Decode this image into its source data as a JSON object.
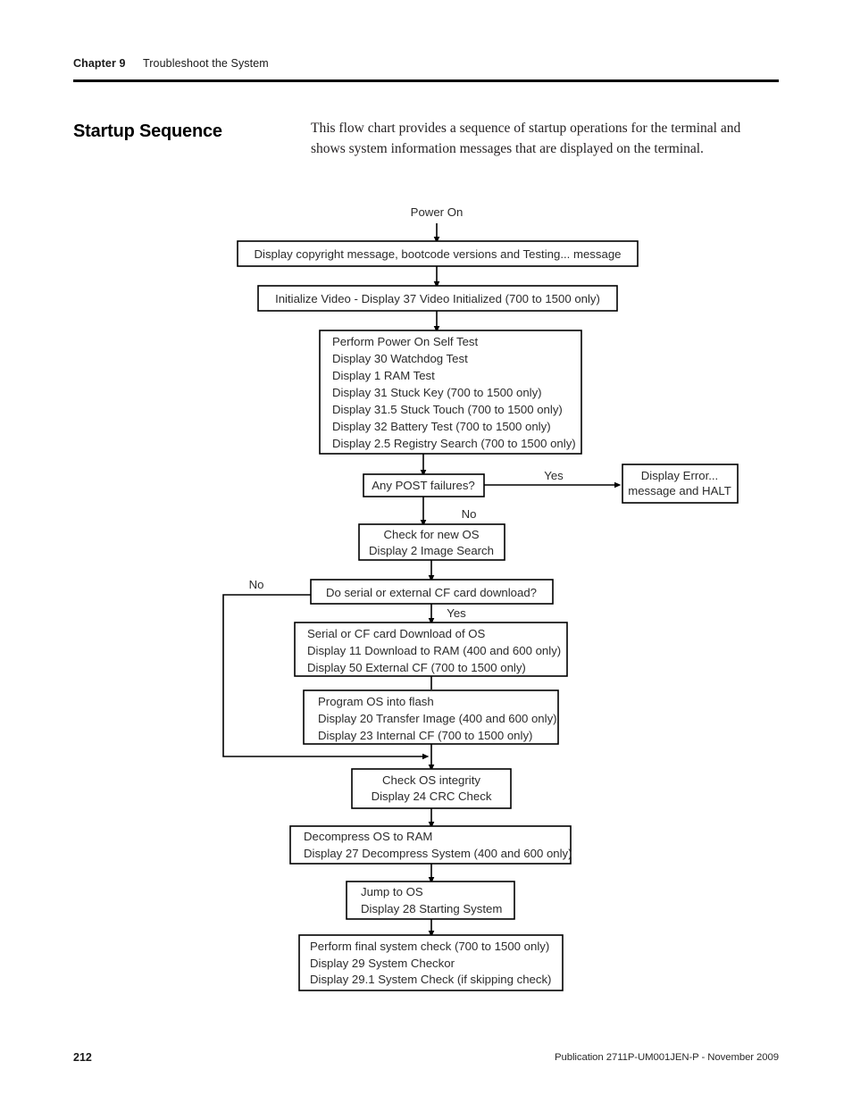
{
  "header": {
    "chapter": "Chapter 9",
    "title": "Troubleshoot the System"
  },
  "section": {
    "title": "Startup Sequence",
    "intro": "This flow chart provides a sequence of startup operations for the terminal and shows system information messages that are displayed on the terminal."
  },
  "flowchart": {
    "start_label": "Power On",
    "nodes": {
      "copyright": "Display copyright message, bootcode versions and Testing... message",
      "init_video": "Initialize Video - Display 37 Video Initialized (700 to 1500 only)",
      "post": [
        "Perform Power On Self Test",
        "Display 30 Watchdog Test",
        "Display 1 RAM Test",
        "Display 31 Stuck Key (700 to 1500 only)",
        "Display 31.5 Stuck Touch (700 to 1500 only)",
        "Display 32 Battery Test (700 to 1500 only)",
        "Display 2.5 Registry Search (700 to 1500 only)"
      ],
      "post_decision": "Any POST failures?",
      "error_halt": [
        "Display Error...",
        "message and HALT"
      ],
      "check_new_os": [
        "Check for new OS",
        "Display 2 Image Search"
      ],
      "download_decision": "Do serial or external CF card download?",
      "download_os": [
        "Serial or CF card Download of OS",
        "Display 11 Download to RAM (400 and 600 only)",
        "Display 50 External CF (700 to 1500 only)"
      ],
      "program_flash": [
        "Program OS into flash",
        "Display 20 Transfer Image (400 and 600 only)",
        "Display 23 Internal CF (700 to 1500 only)"
      ],
      "check_integrity": [
        "Check OS integrity",
        "Display 24 CRC Check"
      ],
      "decompress": [
        "Decompress OS to RAM",
        "Display 27 Decompress System (400 and 600 only)"
      ],
      "jump_to_os": [
        "Jump to OS",
        "Display 28 Starting System"
      ],
      "final_check": [
        "Perform final system check (700 to 1500 only)",
        "Display 29 System Checkor",
        "Display 29.1 System Check (if skipping check)"
      ]
    },
    "edge_labels": {
      "post_yes": "Yes",
      "post_no": "No",
      "download_no": "No",
      "download_yes": "Yes"
    }
  },
  "footer": {
    "page_number": "212",
    "publication": "Publication 2711P-UM001JEN-P - November 2009"
  }
}
